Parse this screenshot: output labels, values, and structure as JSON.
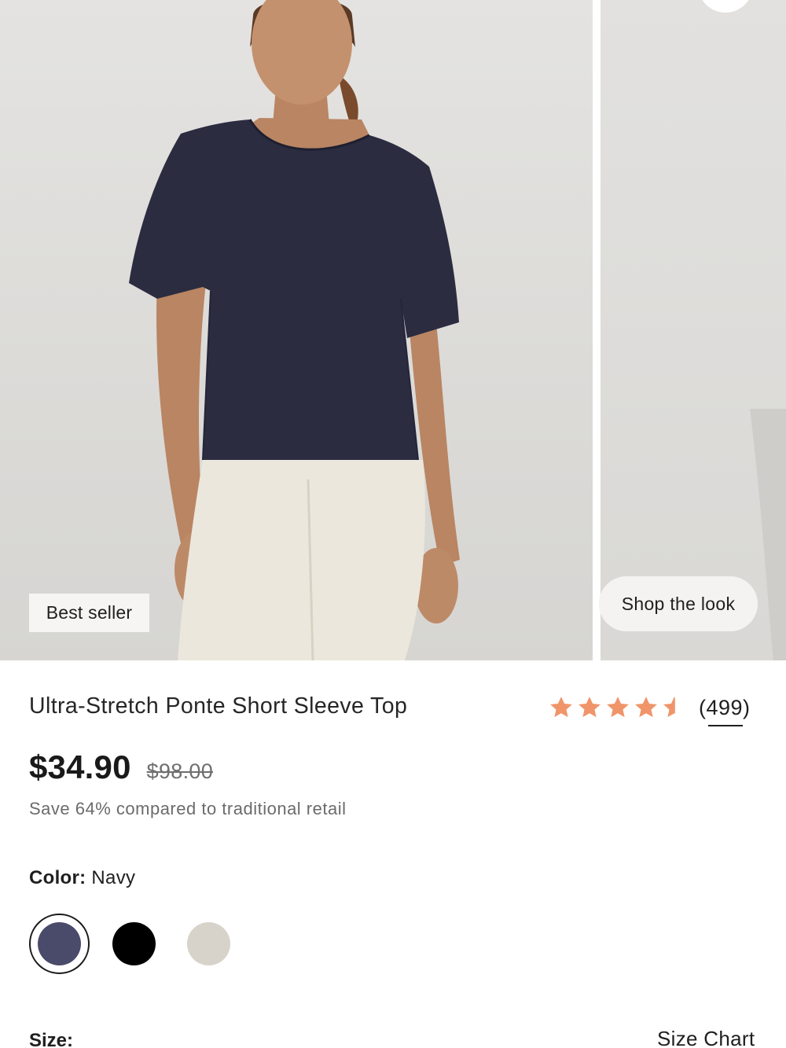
{
  "gallery": {
    "badge": "Best seller",
    "shop_the_look": "Shop the look"
  },
  "product": {
    "title": "Ultra-Stretch Ponte Short Sleeve Top",
    "rating": 4.5,
    "review_count": "(499)",
    "price": "$34.90",
    "original_price": "$98.00",
    "savings_note": "Save 64% compared to traditional retail"
  },
  "color": {
    "label": "Color:",
    "selected": "Navy",
    "swatches": [
      {
        "name": "Navy",
        "hex": "#4a4a6a",
        "selected": true
      },
      {
        "name": "Black",
        "hex": "#000000",
        "selected": false
      },
      {
        "name": "Bone",
        "hex": "#d7d3cb",
        "selected": false
      }
    ]
  },
  "size": {
    "label": "Size:",
    "chart_link": "Size Chart"
  },
  "colors": {
    "star": "#f0956a",
    "text": "#1f1f1f",
    "muted": "#6b6b6b"
  },
  "icons": [
    "star-icon",
    "half-star-icon"
  ]
}
